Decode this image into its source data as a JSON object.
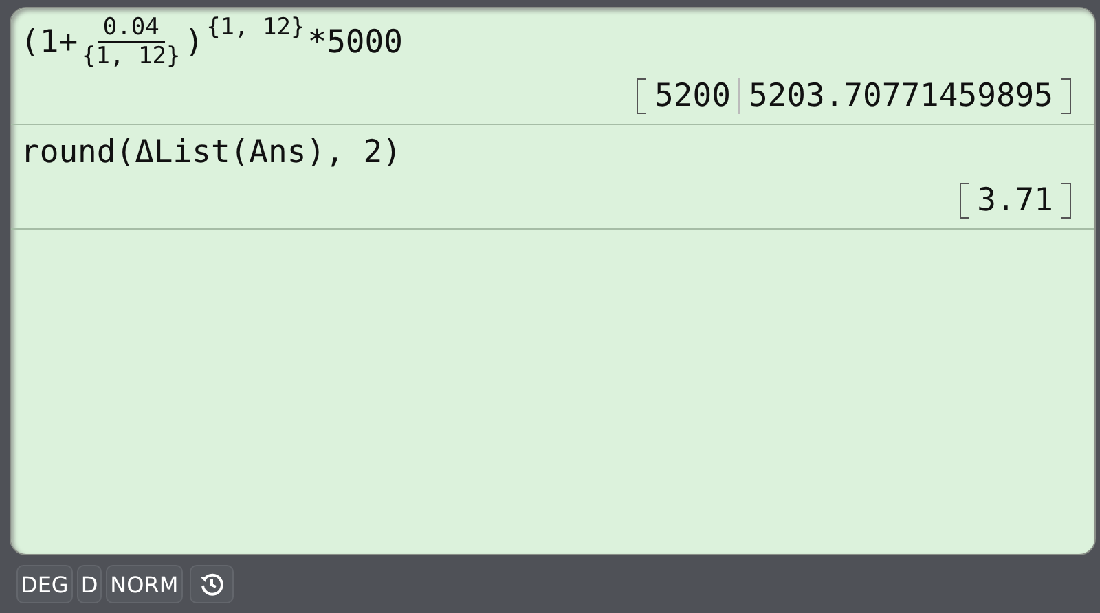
{
  "history": [
    {
      "input": [
        {
          "kind": "text",
          "text": "(1+"
        },
        {
          "kind": "fraction",
          "numerator": "0.04",
          "denominator": "{1, 12}"
        },
        {
          "kind": "text",
          "text": ")"
        },
        {
          "kind": "sup",
          "text": "{1, 12}"
        },
        {
          "kind": "text",
          "text": "*5000"
        }
      ],
      "result": [
        "5200",
        "5203.70771459895"
      ]
    },
    {
      "input": [
        {
          "kind": "text",
          "text": "round(ΔList(Ans), 2)"
        }
      ],
      "result": [
        "3.71"
      ]
    }
  ],
  "status_bar": {
    "modes": [
      "DEG",
      "D",
      "NORM"
    ]
  }
}
